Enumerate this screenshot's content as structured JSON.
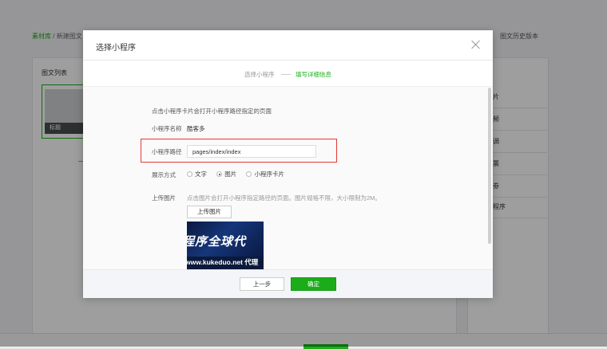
{
  "background": {
    "breadcrumb": {
      "root": "素材库",
      "separator": "/",
      "current": "新建图文"
    },
    "history_link": "图文历史版本",
    "list_title": "图文列表",
    "card_caption": "标题",
    "right_items": [
      "片",
      "频",
      "调",
      "票",
      "劵",
      "程序"
    ]
  },
  "modal": {
    "title": "选择小程序",
    "steps": {
      "step1": "选择小程序",
      "step2": "填写详细信息"
    },
    "hint": "点击小程序卡片会打开小程序路径指定的页面",
    "name_label": "小程序名称",
    "name_value": "酷客多",
    "path_label": "小程序路径",
    "path_value": "pages/index/index",
    "display_label": "展示方式",
    "display_options": [
      {
        "label": "文字",
        "checked": false
      },
      {
        "label": "图片",
        "checked": true
      },
      {
        "label": "小程序卡片",
        "checked": false
      }
    ],
    "upload_label": "上传图片",
    "upload_hint": "点击图片会打开小程序指定路径的页面。图片规格不限，大小限制为2M。",
    "upload_button": "上传图片",
    "preview_text_line1": "程序全球代",
    "preview_text_line2": "www.kukeduo.net 代理",
    "prev_button": "上一步",
    "ok_button": "确定"
  },
  "colors": {
    "accent": "#1aad19",
    "highlight": "#e53935"
  }
}
